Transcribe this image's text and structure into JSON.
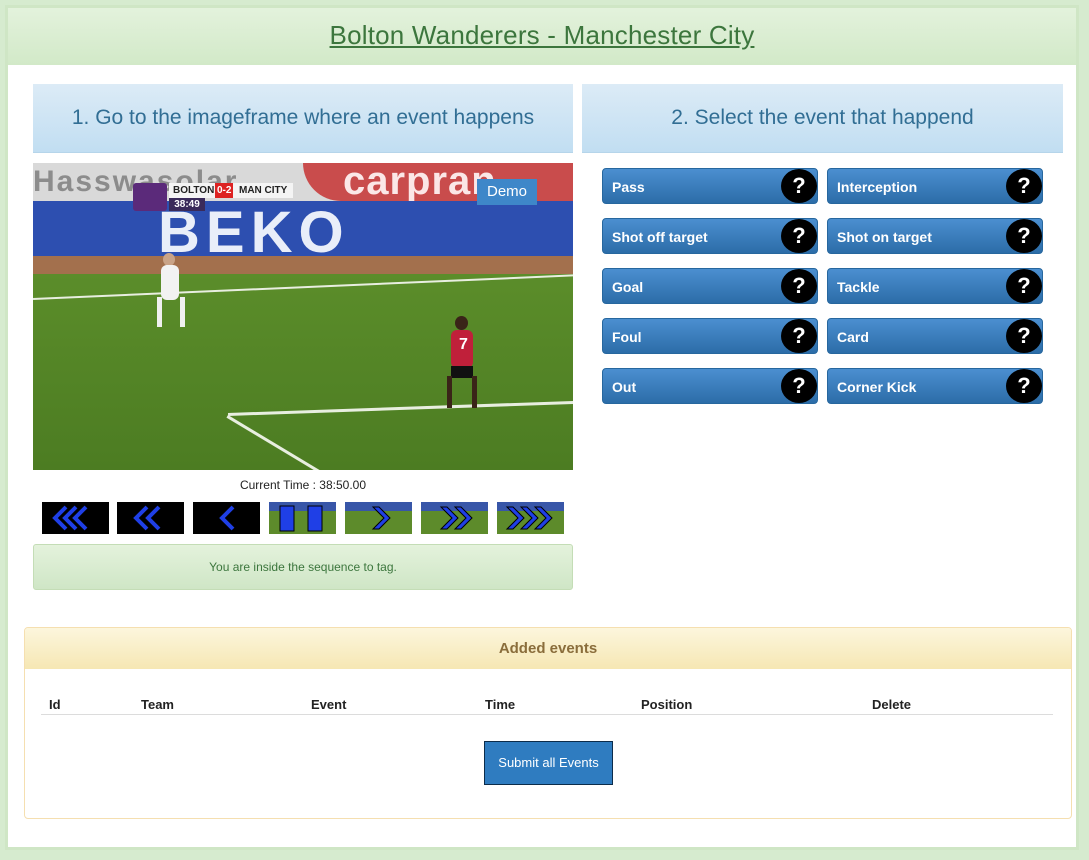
{
  "header": {
    "title": "Bolton Wanderers - Manchester City"
  },
  "left_panel": {
    "heading": "1. Go to the imageframe where an event happens",
    "video": {
      "stand_text": "Hasswasolar",
      "ad_banner": "carpran",
      "ad_board": "BEKO",
      "scoreboard": {
        "home": "BOLTON",
        "result": "0-2",
        "away": "MAN CITY",
        "clock": "38:49"
      },
      "demo_label": "Demo",
      "player_number": "7"
    },
    "current_time": "Current Time : 38:50.00",
    "controls": [
      {
        "name": "rewind-fast-button",
        "icon": "triple-chevron-left-icon"
      },
      {
        "name": "rewind-button",
        "icon": "double-chevron-left-icon"
      },
      {
        "name": "step-back-button",
        "icon": "chevron-left-icon"
      },
      {
        "name": "pause-button",
        "icon": "pause-icon"
      },
      {
        "name": "step-forward-button",
        "icon": "chevron-right-icon"
      },
      {
        "name": "forward-button",
        "icon": "double-chevron-right-icon"
      },
      {
        "name": "forward-fast-button",
        "icon": "triple-chevron-right-icon"
      }
    ],
    "status_message": "You are inside the sequence to tag."
  },
  "right_panel": {
    "heading": "2. Select the event that happend",
    "events": [
      {
        "label": "Pass"
      },
      {
        "label": "Interception"
      },
      {
        "label": "Shot off target"
      },
      {
        "label": "Shot on target"
      },
      {
        "label": "Goal"
      },
      {
        "label": "Tackle"
      },
      {
        "label": "Foul"
      },
      {
        "label": "Card"
      },
      {
        "label": "Out"
      },
      {
        "label": "Corner Kick"
      }
    ],
    "help_symbol": "?"
  },
  "added_events": {
    "heading": "Added events",
    "columns": [
      "Id",
      "Team",
      "Event",
      "Time",
      "Position",
      "Delete"
    ],
    "rows": [],
    "submit_label": "Submit all Events"
  },
  "colors": {
    "page_background": "#d6ebcf",
    "title": "#3c763d",
    "event_button": "#2c6da8",
    "added_events_header": "#f6e7b4",
    "submit_button": "#2f7cc0"
  }
}
